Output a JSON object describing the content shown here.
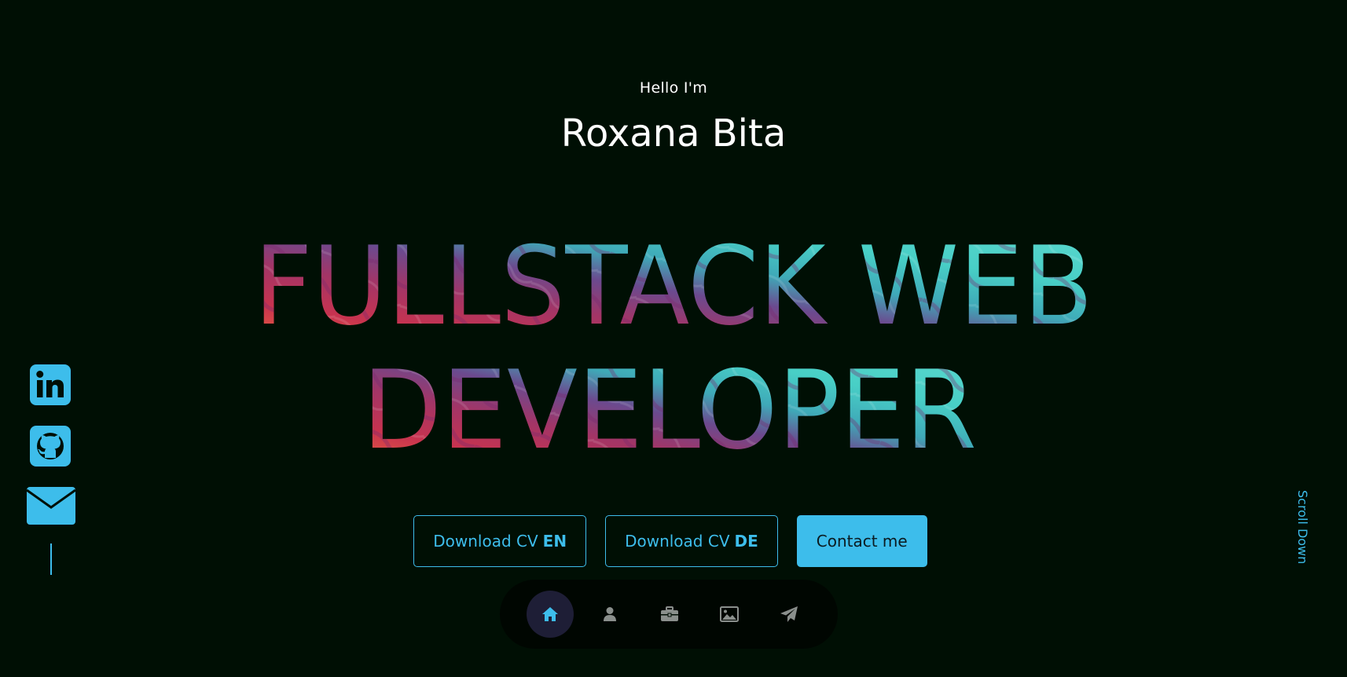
{
  "hero": {
    "greeting": "Hello I'm",
    "name": "Roxana Bita",
    "headline_line1": "FULLSTACK WEB",
    "headline_line2": "DEVELOPER"
  },
  "buttons": {
    "cv_en_prefix": "Download CV",
    "cv_en_lang": "EN",
    "cv_de_prefix": "Download CV",
    "cv_de_lang": "DE",
    "contact": "Contact me"
  },
  "nav": {
    "items": [
      {
        "icon": "home-icon",
        "active": true
      },
      {
        "icon": "user-icon",
        "active": false
      },
      {
        "icon": "briefcase-icon",
        "active": false
      },
      {
        "icon": "image-icon",
        "active": false
      },
      {
        "icon": "paper-plane-icon",
        "active": false
      }
    ]
  },
  "social": {
    "items": [
      "linkedin-icon",
      "github-icon",
      "mail-icon"
    ]
  },
  "scroll_label": "Scroll Down",
  "colors": {
    "background": "#000f04",
    "accent": "#3dbdeb",
    "text": "#ffffff",
    "nav_active_bg": "#1e1e36",
    "nav_icon": "#8a8f8c"
  }
}
